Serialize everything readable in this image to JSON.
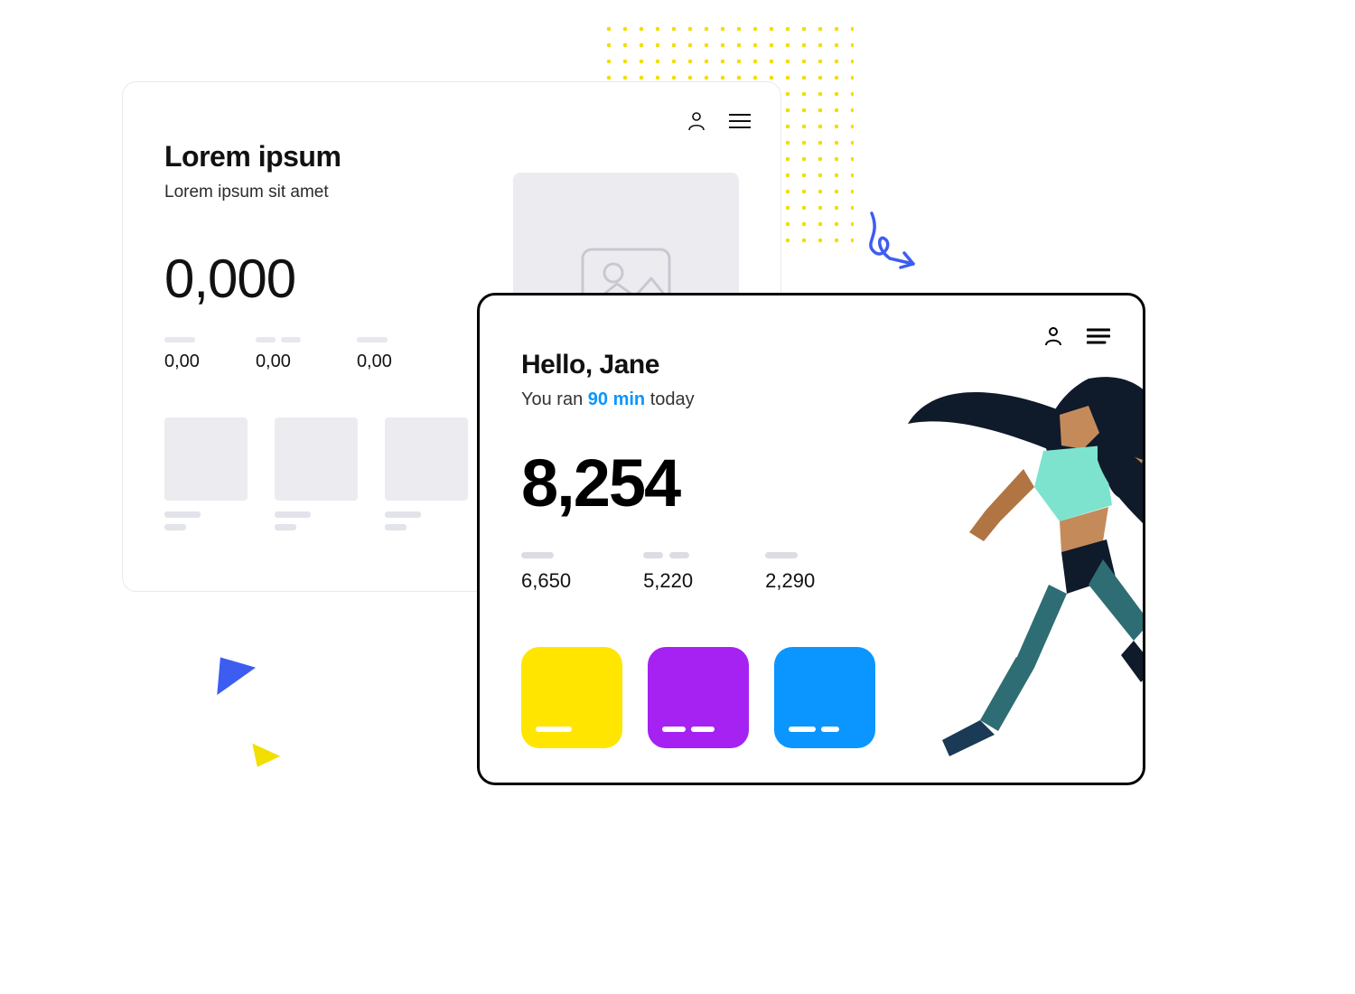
{
  "back_card": {
    "title": "Lorem ipsum",
    "subtitle": "Lorem ipsum sit amet",
    "main_value": "0,000",
    "metrics": [
      "0,00",
      "0,00",
      "0,00"
    ]
  },
  "front_card": {
    "greeting": "Hello, Jane",
    "subline_prefix": "You ran ",
    "subline_highlight": "90 min",
    "subline_suffix": " today",
    "main_value": "8,254",
    "metrics": [
      "6,650",
      "5,220",
      "2,290"
    ],
    "tile_colors": [
      "#ffe500",
      "#a522f2",
      "#0a95ff"
    ]
  },
  "colors": {
    "accent_yellow": "#ffe500",
    "accent_purple": "#a522f2",
    "accent_blue": "#0a95ff",
    "highlight": "#0a95ff"
  }
}
